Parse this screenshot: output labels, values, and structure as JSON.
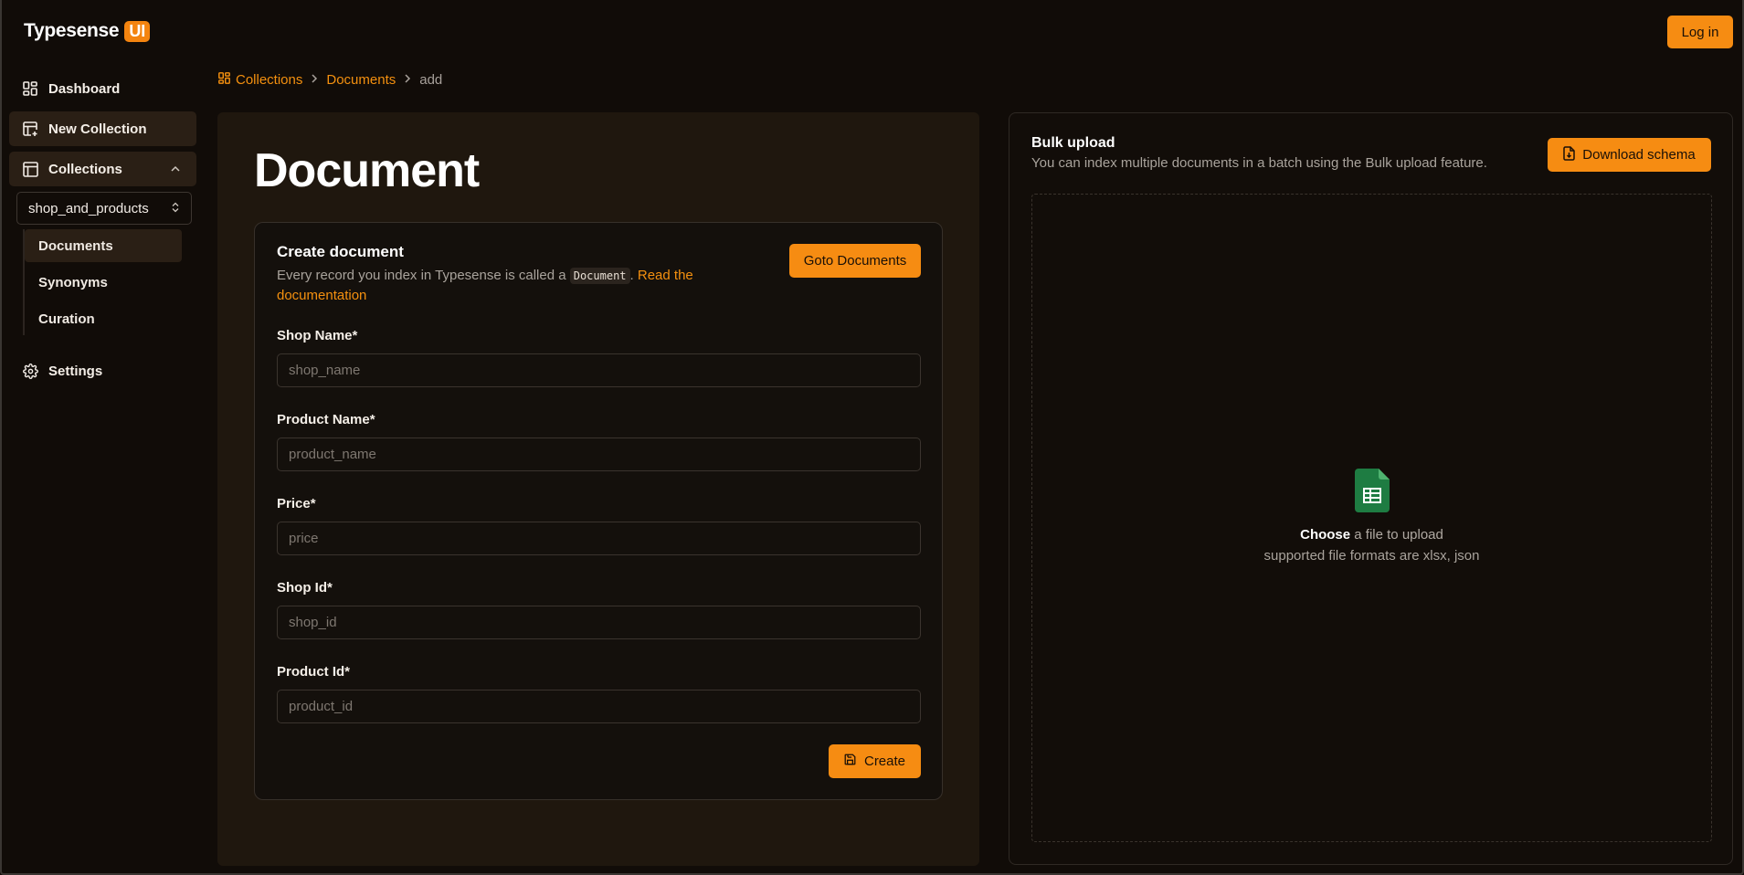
{
  "brand": {
    "name": "Typesense",
    "badge": "UI"
  },
  "header": {
    "login_label": "Log in"
  },
  "sidebar": {
    "items": [
      {
        "label": "Dashboard",
        "icon": "dashboard-icon"
      },
      {
        "label": "New Collection",
        "icon": "table-plus-icon"
      },
      {
        "label": "Collections",
        "icon": "table-icon"
      }
    ],
    "collection_select": {
      "value": "shop_and_products"
    },
    "subitems": [
      {
        "label": "Documents"
      },
      {
        "label": "Synonyms"
      },
      {
        "label": "Curation"
      }
    ],
    "settings_label": "Settings"
  },
  "breadcrumb": {
    "collections": "Collections",
    "documents": "Documents",
    "current": "add"
  },
  "main": {
    "title": "Document",
    "card": {
      "title": "Create document",
      "desc_prefix": "Every record you index in Typesense is called a",
      "desc_code": "Document",
      "desc_suffix": ".",
      "read_link": "Read the documentation",
      "goto_label": "Goto Documents",
      "fields": [
        {
          "label": "Shop Name*",
          "placeholder": "shop_name"
        },
        {
          "label": "Product Name*",
          "placeholder": "product_name"
        },
        {
          "label": "Price*",
          "placeholder": "price"
        },
        {
          "label": "Shop Id*",
          "placeholder": "shop_id"
        },
        {
          "label": "Product Id*",
          "placeholder": "product_id"
        }
      ],
      "create_label": "Create"
    }
  },
  "bulk": {
    "title": "Bulk upload",
    "description": "You can index multiple documents in a batch using the Bulk upload feature.",
    "download_label": "Download schema",
    "choose": "Choose",
    "choose_rest": " a file to upload",
    "formats": "supported file formats are xlsx, json"
  },
  "colors": {
    "accent": "#f68c12",
    "background": "#110c08",
    "panel": "#1f170e",
    "sheet_icon": "#1e7c42"
  }
}
